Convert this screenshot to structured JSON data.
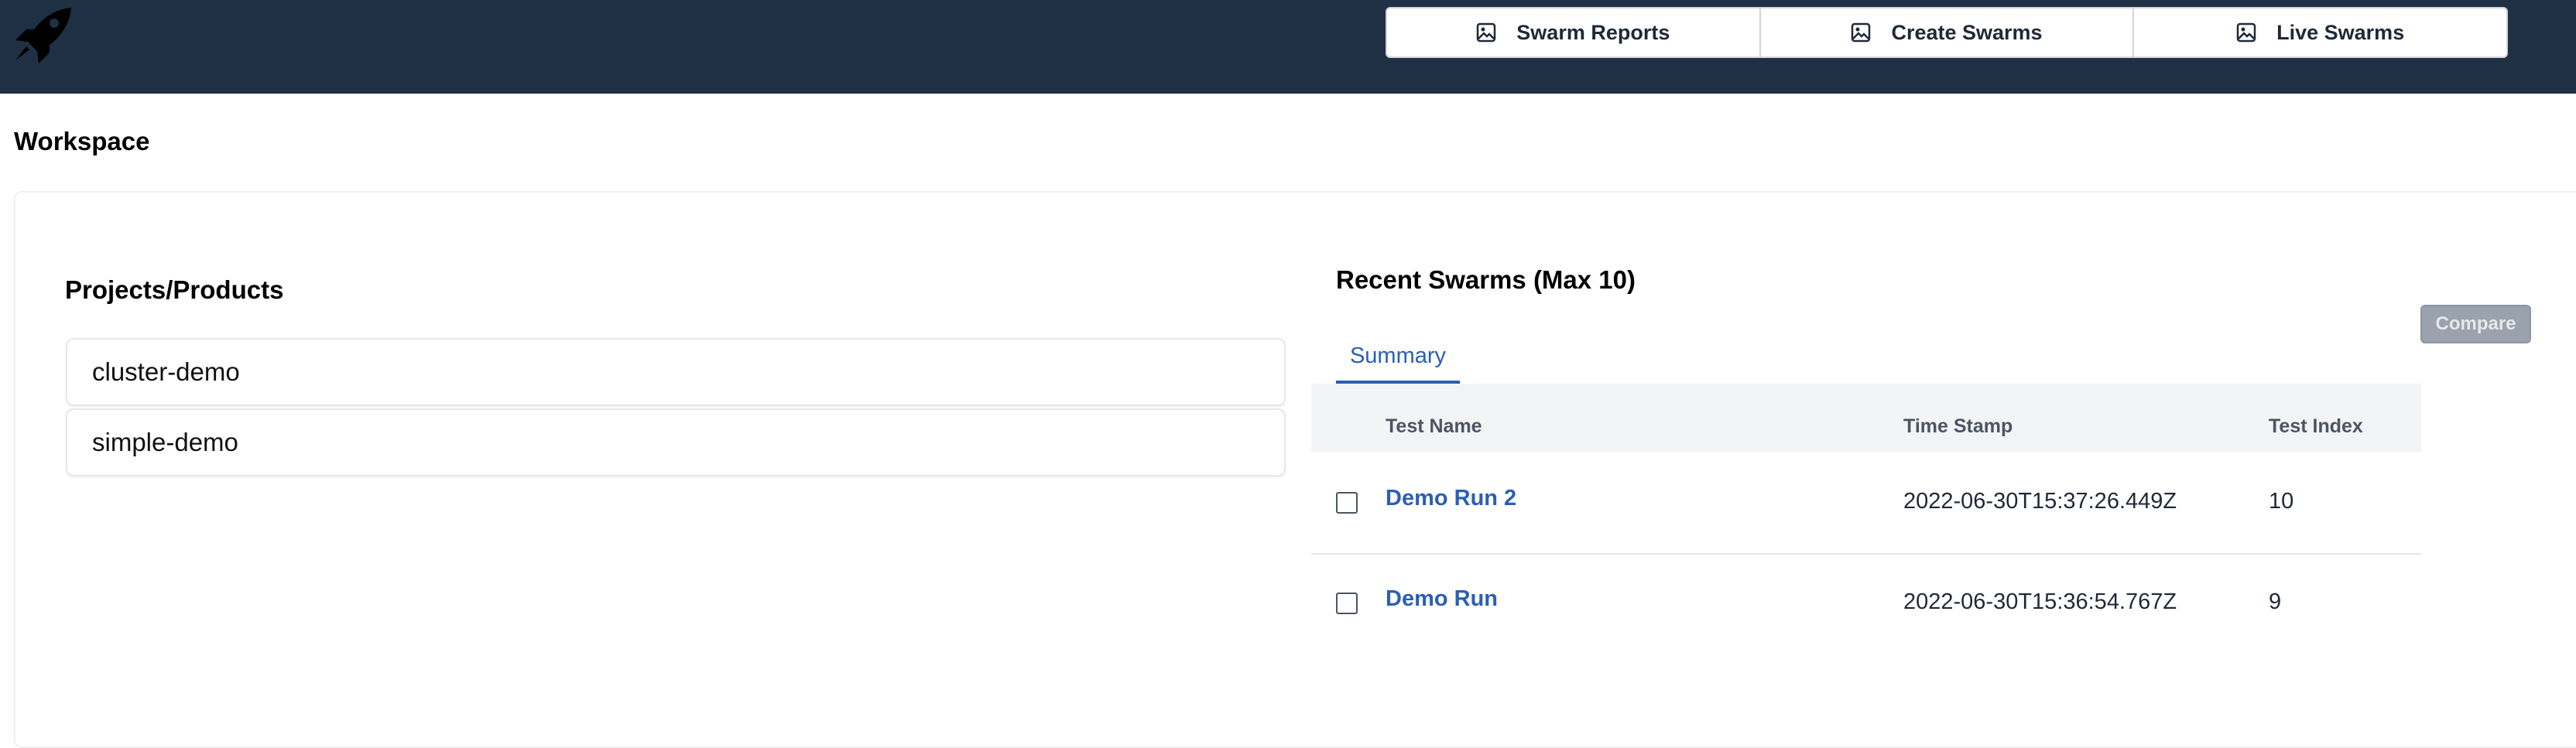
{
  "navbar": {
    "logo_icon": "rocket-icon",
    "buttons": [
      {
        "label": "Swarm Reports",
        "icon": "image-icon"
      },
      {
        "label": "Create Swarms",
        "icon": "image-icon"
      },
      {
        "label": "Live Swarms",
        "icon": "image-icon"
      }
    ],
    "colors": {
      "background": "#1f2f44",
      "button_bg": "#ffffff"
    }
  },
  "page": {
    "title": "Workspace"
  },
  "projects": {
    "title": "Projects/Products",
    "items": [
      {
        "label": "cluster-demo"
      },
      {
        "label": "simple-demo"
      }
    ]
  },
  "swarms": {
    "title": "Recent Swarms (Max 10)",
    "compare_label": "Compare",
    "tabs": [
      {
        "label": "Summary",
        "active": true
      }
    ],
    "columns": [
      "Test Name",
      "Time Stamp",
      "Test Index"
    ],
    "rows": [
      {
        "name": "Demo Run 2",
        "timestamp": "2022-06-30T15:37:26.449Z",
        "index": "10",
        "checked": false
      },
      {
        "name": "Demo Run",
        "timestamp": "2022-06-30T15:36:54.767Z",
        "index": "9",
        "checked": false
      }
    ],
    "colors": {
      "link": "#2b5fb3",
      "compare_disabled": "#9aa3ad"
    }
  }
}
